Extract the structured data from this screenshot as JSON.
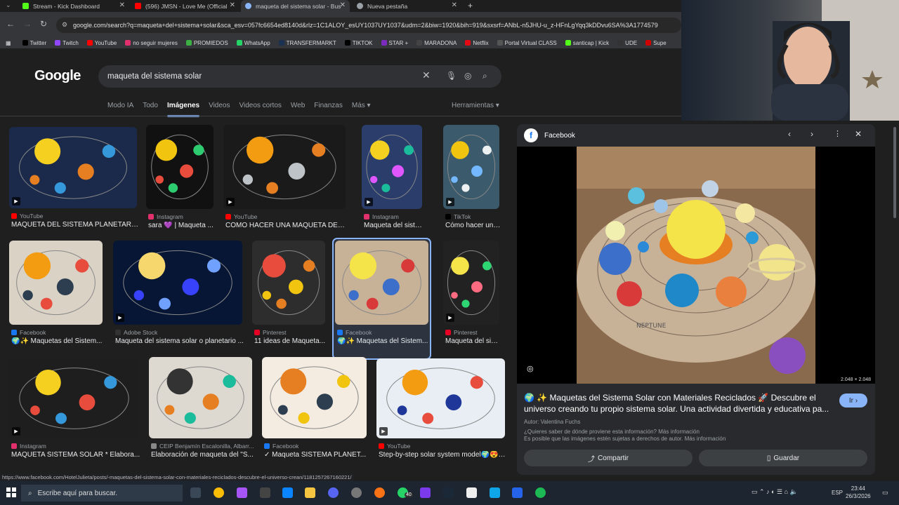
{
  "browser": {
    "tabs": [
      {
        "label": "Stream - Kick Dashboard",
        "color": "#53fc18"
      },
      {
        "label": "(596) JMSN - Love Me (Official",
        "color": "#ff0000"
      },
      {
        "label": "maqueta del sistema solar - Bus",
        "color": "#8ab4f8"
      },
      {
        "label": "Nueva pestaña",
        "color": "#9aa0a6"
      }
    ],
    "new_tab": "+",
    "url": "google.com/search?q=maqueta+del+sistema+solar&sca_esv=057fc6654ed8140d&rlz=1C1ALOY_esUY1037UY1037&udm=2&biw=1920&bih=919&sxsrf=ANbL-n5JHU-u_z-HFnLgYqq3kDDvu6SA%3A1774579",
    "bookmarks": [
      {
        "label": "Twitter",
        "color": "#000000"
      },
      {
        "label": "Twitch",
        "color": "#9146ff"
      },
      {
        "label": "YouTube",
        "color": "#ff0000"
      },
      {
        "label": "no seguir mujeres",
        "color": "#e1306c"
      },
      {
        "label": "PROMIEDOS",
        "color": "#3cb043"
      },
      {
        "label": "WhatsApp",
        "color": "#25d366"
      },
      {
        "label": "TRANSFERMARKT",
        "color": "#1a3151"
      },
      {
        "label": "TIKTOK",
        "color": "#000000"
      },
      {
        "label": "STAR +",
        "color": "#7b2cbf"
      },
      {
        "label": "MARADONA",
        "color": "#444444"
      },
      {
        "label": "Netflix",
        "color": "#e50914"
      },
      {
        "label": "Portal Virtual CLASS",
        "color": "#555555"
      },
      {
        "label": "santicap | Kick",
        "color": "#53fc18"
      },
      {
        "label": "UDE",
        "color": "#333333"
      },
      {
        "label": "Supe",
        "color": "#d00000"
      }
    ]
  },
  "google": {
    "logo": "Google",
    "query": "maqueta del sistema solar",
    "tabs": [
      "Modo IA",
      "Todo",
      "Imágenes",
      "Videos",
      "Videos cortos",
      "Web",
      "Finanzas",
      "Más ▾"
    ],
    "tools": "Herramientas ▾"
  },
  "results": [
    {
      "source": "YouTube",
      "title": "MAQUETA DEL SISTEMA PLANETARI...",
      "sc": "#ff0000"
    },
    {
      "source": "Instagram",
      "title": "sara 💜 | Maqueta ...",
      "sc": "#e1306c"
    },
    {
      "source": "YouTube",
      "title": "CÓMO HACER UNA MAQUETA DEL S...",
      "sc": "#ff0000"
    },
    {
      "source": "Instagram",
      "title": "Maqueta del siste...",
      "sc": "#e1306c"
    },
    {
      "source": "TikTok",
      "title": "Cómo hacer una m...",
      "sc": "#000000"
    },
    {
      "source": "Facebook",
      "title": "🌍✨ Maquetas del Sistem...",
      "sc": "#1877f2"
    },
    {
      "source": "Adobe Stock",
      "title": "Maqueta del sistema solar o planetario ...",
      "sc": "#333333"
    },
    {
      "source": "Pinterest",
      "title": "11 ideas de Maqueta...",
      "sc": "#e60023"
    },
    {
      "source": "Facebook",
      "title": "🌍✨ Maquetas del Sistem...",
      "sc": "#1877f2"
    },
    {
      "source": "Pinterest",
      "title": "Maqueta del siste...",
      "sc": "#e60023"
    },
    {
      "source": "Instagram",
      "title": "MAQUETA SISTEMA SOLAR * Elabora...",
      "sc": "#e1306c"
    },
    {
      "source": "CEIP Benjamín Escalonilla, Albarr...",
      "title": "Elaboración de maqueta del \"S...",
      "sc": "#888888"
    },
    {
      "source": "Facebook",
      "title": "✓ Maqueta SISTEMA PLANET...",
      "sc": "#1877f2"
    },
    {
      "source": "YouTube",
      "title": "Step-by-step solar system model🌍😍M...",
      "sc": "#ff0000"
    }
  ],
  "panel": {
    "source": "Facebook",
    "dims": "2.048 × 2.048",
    "title": "🌍 ✨ Maquetas del Sistema Solar con Materiales Reciclados 🚀 Descubre el universo creando tu propio sistema solar. Una actividad divertida y educativa pa...",
    "go": "Ir ›",
    "author": "Autor: Valentina Fuchs",
    "info1": "¿Quieres saber de dónde proviene esta información? Más información",
    "info2": "Es posible que las imágenes estén sujetas a derechos de autor. Más información",
    "share": "Compartir",
    "save": "Guardar",
    "neptune": "NEPTUNE"
  },
  "status_url": "https://www.facebook.com/HotelJulieta/posts/-maquetas-del-sistema-solar-con-materiales-reciclados-descubre-el-universo-crean/1181257267160221/",
  "taskbar": {
    "search": "Escribe aquí para buscar.",
    "lang": "ESP",
    "time": "23:44",
    "date": "26/3/2026",
    "badge": "40"
  },
  "colors": {
    "accent": "#8ab4f8",
    "bg": "#1f1f1f"
  }
}
